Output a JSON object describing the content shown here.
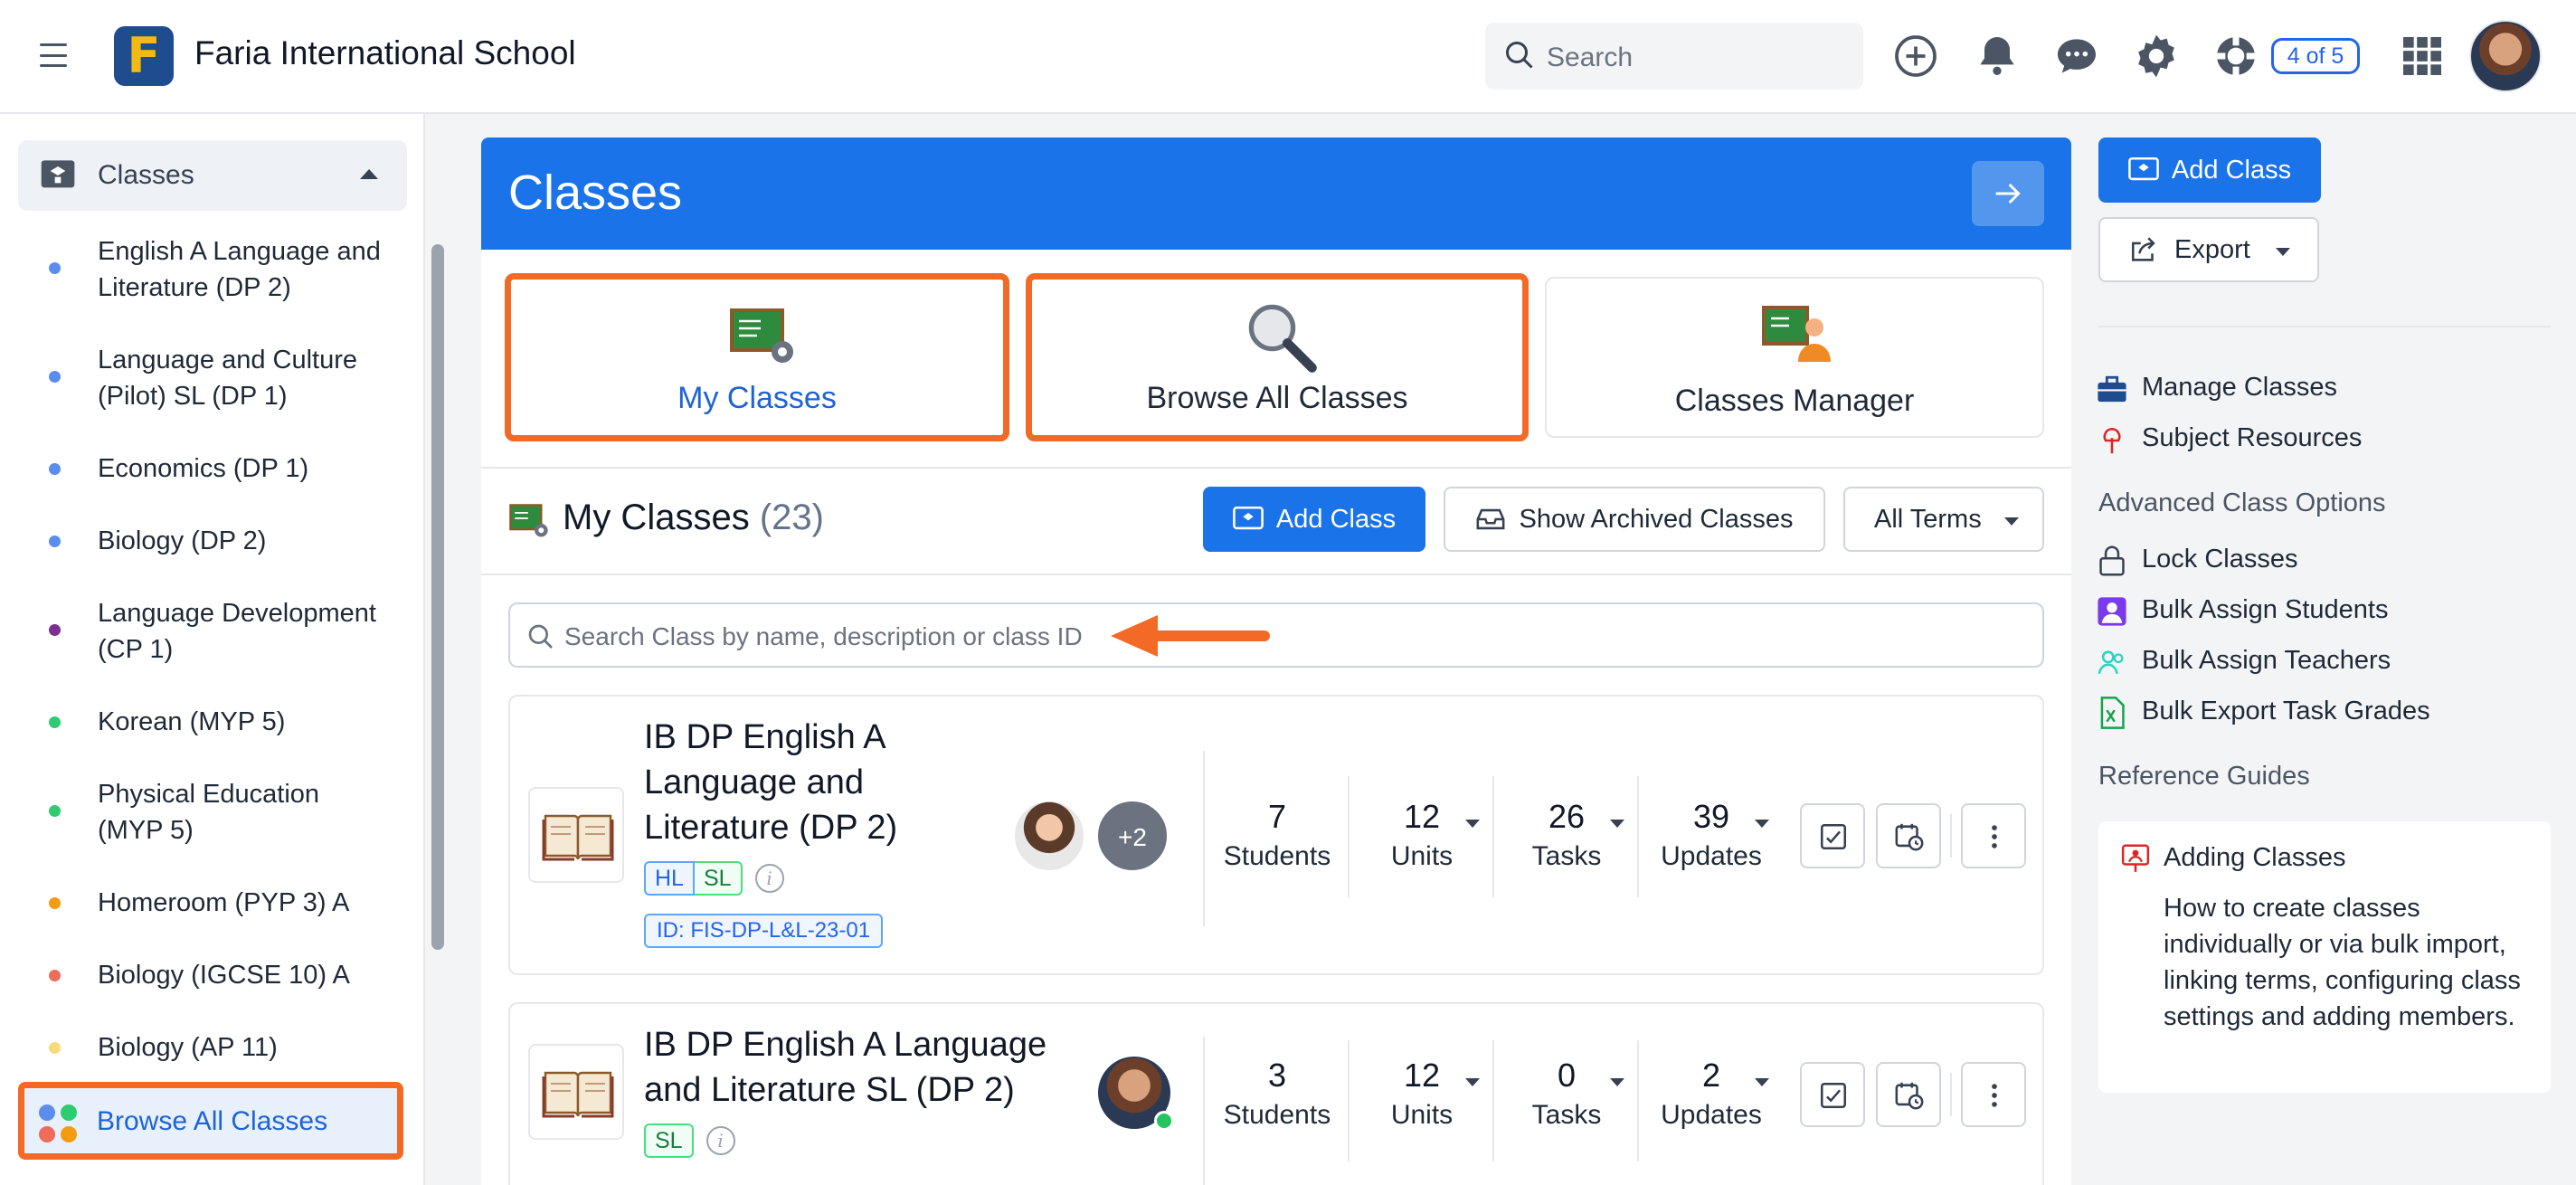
{
  "header": {
    "school_name": "Faria International School",
    "search_placeholder": "Search",
    "page_indicator": "4 of 5"
  },
  "sidebar": {
    "section_label": "Classes",
    "items": [
      {
        "label": "English A Language and Literature (DP 2)",
        "color": "#5b8def"
      },
      {
        "label": "Language and Culture (Pilot) SL (DP 1)",
        "color": "#5b8def"
      },
      {
        "label": "Economics (DP 1)",
        "color": "#5b8def"
      },
      {
        "label": "Biology (DP 2)",
        "color": "#5b8def"
      },
      {
        "label": "Language Development (CP 1)",
        "color": "#7b2f8e"
      },
      {
        "label": "Korean (MYP 5)",
        "color": "#2ecc71"
      },
      {
        "label": "Physical Education (MYP 5)",
        "color": "#2ecc71"
      },
      {
        "label": "Homeroom (PYP 3) A",
        "color": "#f39c12"
      },
      {
        "label": "Biology (IGCSE 10) A",
        "color": "#ef6b5b"
      },
      {
        "label": "Biology (AP 11)",
        "color": "#f5dc7a"
      }
    ],
    "browse_all": "Browse All Classes"
  },
  "main": {
    "title": "Classes",
    "tiles": [
      {
        "label": "My Classes"
      },
      {
        "label": "Browse All Classes"
      },
      {
        "label": "Classes Manager"
      }
    ],
    "section_title": "My Classes",
    "section_count": "(23)",
    "add_class": "Add Class",
    "show_archived": "Show Archived Classes",
    "terms_filter": "All Terms",
    "search_placeholder": "Search Class by name, description or class ID",
    "classes": [
      {
        "name": "IB DP English A Language and Literature (DP 2)",
        "tags": [
          "HL",
          "SL"
        ],
        "class_id": "ID: FIS-DP-L&L-23-01",
        "extra_members": "+2",
        "stats": [
          {
            "num": "7",
            "label": "Students"
          },
          {
            "num": "12",
            "label": "Units"
          },
          {
            "num": "26",
            "label": "Tasks"
          },
          {
            "num": "39",
            "label": "Updates"
          }
        ]
      },
      {
        "name": "IB DP English A Language and Literature SL (DP 2)",
        "tags": [
          "SL"
        ],
        "stats": [
          {
            "num": "3",
            "label": "Students"
          },
          {
            "num": "12",
            "label": "Units"
          },
          {
            "num": "0",
            "label": "Tasks"
          },
          {
            "num": "2",
            "label": "Updates"
          }
        ]
      }
    ]
  },
  "right": {
    "add_class": "Add Class",
    "export": "Export",
    "links": [
      "Manage Classes",
      "Subject Resources"
    ],
    "advanced_heading": "Advanced Class Options",
    "advanced_links": [
      "Lock Classes",
      "Bulk Assign Students",
      "Bulk Assign Teachers",
      "Bulk Export Task Grades"
    ],
    "reference_heading": "Reference Guides",
    "guide_title": "Adding Classes",
    "guide_text": "How to create classes individually or via bulk import, linking terms, configuring class settings and adding members."
  },
  "colors": {
    "primary": "#1a73e8",
    "highlight": "#f26a25"
  }
}
